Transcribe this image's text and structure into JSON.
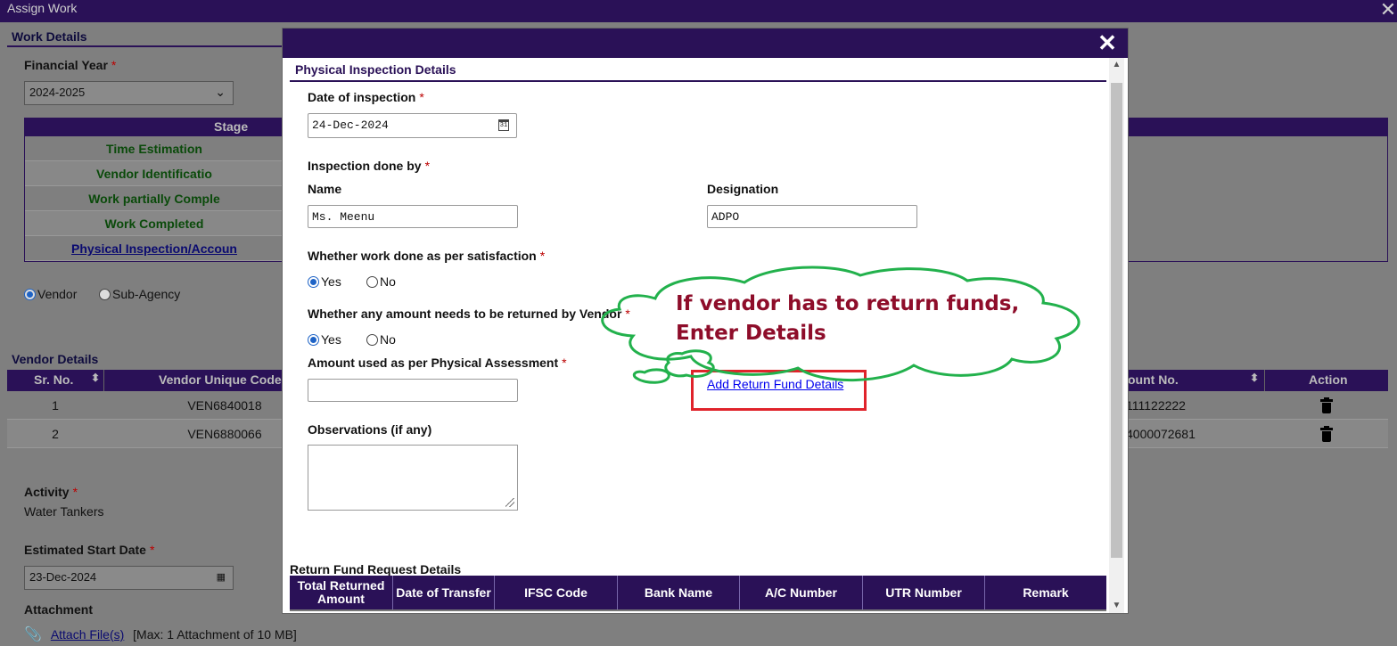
{
  "outer_window": {
    "title": "Assign Work"
  },
  "work_details": {
    "section_title": "Work Details",
    "financial_year_label": "Financial Year",
    "financial_year_value": "2024-2025",
    "stage_header": "Stage",
    "stages": [
      "Time Estimation",
      "Vendor Identificatio",
      "Work partially Comple",
      "Work Completed",
      "Physical Inspection/Accoun"
    ],
    "agency_options": [
      "Vendor",
      "Sub-Agency"
    ],
    "agency_selected": "Vendor"
  },
  "vendor_details": {
    "section_title": "Vendor Details",
    "columns": [
      "Sr. No.",
      "Vendor Unique Code",
      "ount No.",
      "Action"
    ],
    "rows": [
      {
        "sr": "1",
        "code": "VEN6840018",
        "account": "111122222"
      },
      {
        "sr": "2",
        "code": "VEN6880066",
        "account": "4000072681"
      }
    ]
  },
  "activity": {
    "label": "Activity",
    "value": "Water Tankers"
  },
  "estimated_start": {
    "label": "Estimated Start Date",
    "value": "23-Dec-2024"
  },
  "attachment": {
    "label": "Attachment",
    "link": "Attach File(s)",
    "note": "[Max: 1 Attachment of 10 MB]"
  },
  "modal": {
    "section_title": "Physical Inspection Details",
    "date_label": "Date of inspection",
    "date_value": "24-Dec-2024",
    "inspection_by_label": "Inspection done by",
    "name_label": "Name",
    "name_value": "Ms. Meenu",
    "designation_label": "Designation",
    "designation_value": "ADPO",
    "satisfaction_label": "Whether work done as per satisfaction",
    "return_label": "Whether any amount needs to be returned by Vendor",
    "yes": "Yes",
    "no": "No",
    "amount_label": "Amount used as per Physical Assessment",
    "amount_value": "",
    "add_return_link": "Add Return Fund Details",
    "observations_label": "Observations (if any)",
    "return_fund_title": "Return Fund Request Details",
    "return_fund_columns": [
      "Total Returned Amount",
      "Date of Transfer",
      "IFSC Code",
      "Bank Name",
      "A/C Number",
      "UTR Number",
      "Remark"
    ]
  },
  "annotation": {
    "line1": "If vendor has to return funds,",
    "line2": "Enter Details",
    "cloud_color": "#22b14c",
    "text_color": "#8e0d2a",
    "box_color": "#e0232b"
  },
  "colors": {
    "header": "#2a1157",
    "stage_text": "#0a4a0a"
  },
  "icons": [
    "close-icon",
    "calendar-icon",
    "chevron-down-icon",
    "trash-icon",
    "paperclip-icon",
    "sort-icon"
  ]
}
